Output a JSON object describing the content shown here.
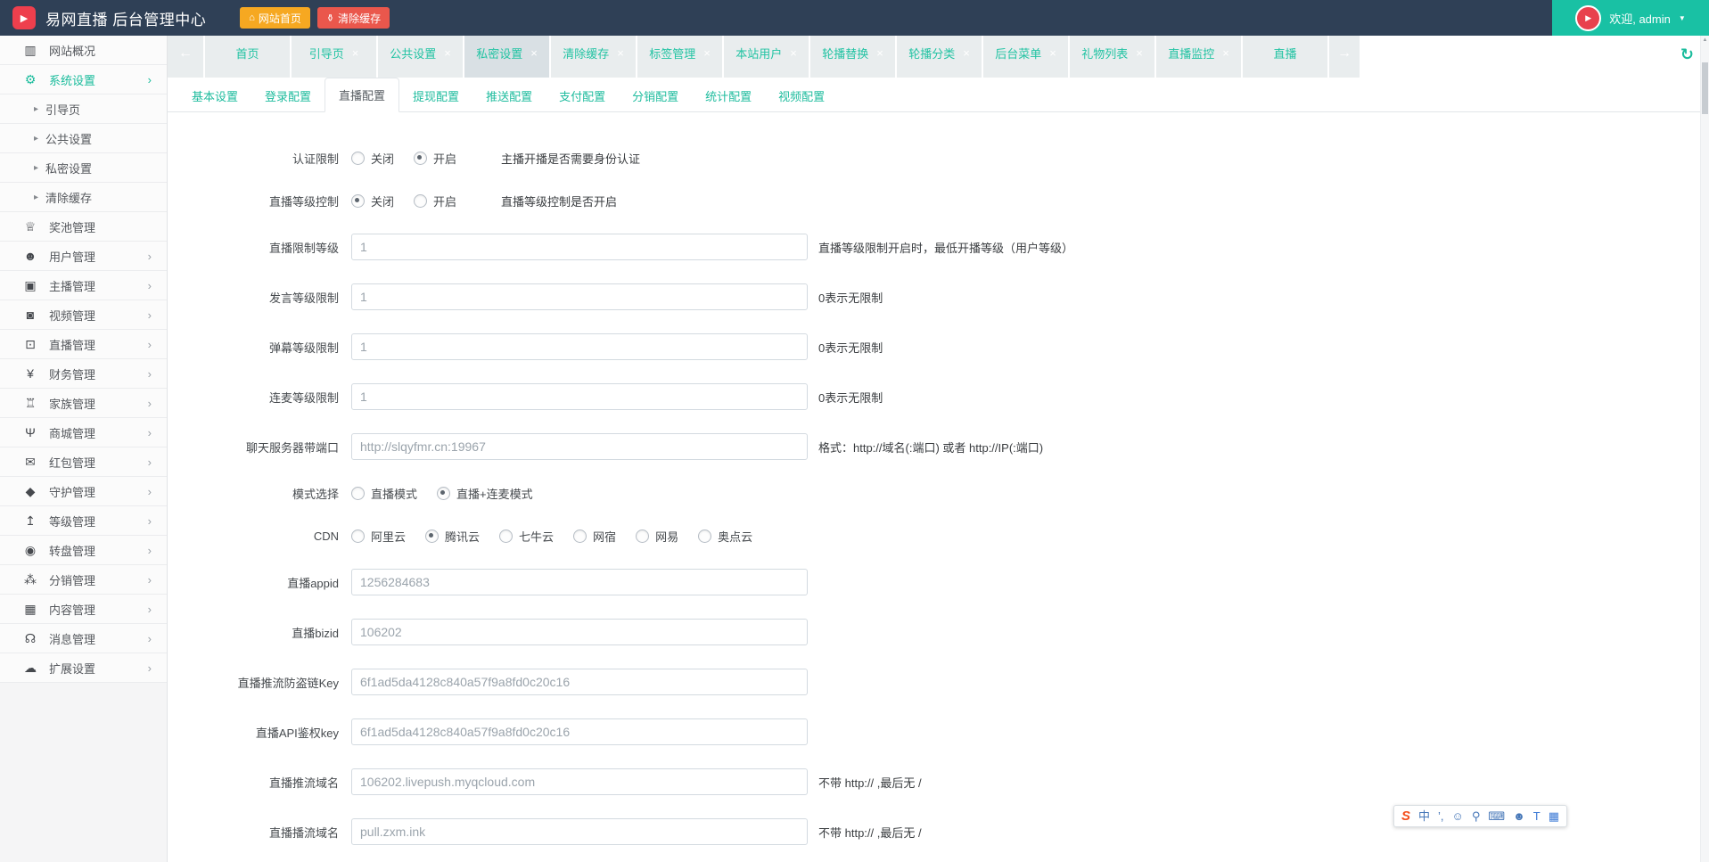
{
  "colors": {
    "header_bg": "#2f4056",
    "accent_teal": "#1abc9c",
    "welcome_bg": "#19c1a4",
    "home_button_bg": "#f6a821",
    "clear_button_bg": "#ea574c",
    "logo_red": "#ee3f4d",
    "tab_bg": "#e9edee",
    "active_tab_bg": "#d9e0e4"
  },
  "icons": {
    "play-icon": "▶",
    "home-icon": "⌂",
    "trash-icon": "⚱",
    "caret-down-icon": "▼",
    "scroll-left-icon": "←",
    "scroll-right-icon": "→",
    "refresh-icon": "↻",
    "close-icon": "×",
    "chevron-right-icon": "›",
    "submenu-arrow-icon": "▸",
    "scroll-up-icon": "▲",
    "chart-icon": "▥",
    "gears-icon": "⚙",
    "trophy-icon": "♕",
    "users-icon": "☻",
    "idcard-icon": "▣",
    "video-icon": "◙",
    "monitor-icon": "⊡",
    "yen-icon": "¥",
    "bank-icon": "♖",
    "cart-icon": "Ψ",
    "envelope-icon": "✉",
    "shield-icon": "◆",
    "level-up-icon": "↥",
    "wheel-icon": "◉",
    "sitemap-icon": "⁂",
    "grid-icon": "▦",
    "bell-icon": "☊",
    "cloud-icon": "☁"
  },
  "header": {
    "title": "易网直播 后台管理中心",
    "home_button": "网站首页",
    "clear_cache_button": "清除缓存",
    "welcome": "欢迎, admin"
  },
  "sidebar": {
    "items": [
      {
        "label": "网站概况",
        "icon": "chart-icon"
      },
      {
        "label": "系统设置",
        "icon": "gears-icon",
        "chevron": true,
        "active": true
      },
      {
        "label": "引导页",
        "sub": true
      },
      {
        "label": "公共设置",
        "sub": true
      },
      {
        "label": "私密设置",
        "sub": true
      },
      {
        "label": "清除缓存",
        "sub": true
      },
      {
        "label": "奖池管理",
        "icon": "trophy-icon"
      },
      {
        "label": "用户管理",
        "icon": "users-icon",
        "chevron": true
      },
      {
        "label": "主播管理",
        "icon": "idcard-icon",
        "chevron": true
      },
      {
        "label": "视频管理",
        "icon": "video-icon",
        "chevron": true
      },
      {
        "label": "直播管理",
        "icon": "monitor-icon",
        "chevron": true
      },
      {
        "label": "财务管理",
        "icon": "yen-icon",
        "chevron": true
      },
      {
        "label": "家族管理",
        "icon": "bank-icon",
        "chevron": true
      },
      {
        "label": "商城管理",
        "icon": "cart-icon",
        "chevron": true
      },
      {
        "label": "红包管理",
        "icon": "envelope-icon",
        "chevron": true
      },
      {
        "label": "守护管理",
        "icon": "shield-icon",
        "chevron": true
      },
      {
        "label": "等级管理",
        "icon": "level-up-icon",
        "chevron": true
      },
      {
        "label": "转盘管理",
        "icon": "wheel-icon",
        "chevron": true
      },
      {
        "label": "分销管理",
        "icon": "sitemap-icon",
        "chevron": true
      },
      {
        "label": "内容管理",
        "icon": "grid-icon",
        "chevron": true
      },
      {
        "label": "消息管理",
        "icon": "bell-icon",
        "chevron": true
      },
      {
        "label": "扩展设置",
        "icon": "cloud-icon",
        "chevron": true
      }
    ]
  },
  "tabbar": {
    "tabs": [
      {
        "label": "首页",
        "closable": false
      },
      {
        "label": "引导页",
        "closable": true
      },
      {
        "label": "公共设置",
        "closable": true
      },
      {
        "label": "私密设置",
        "closable": true,
        "active": true
      },
      {
        "label": "清除缓存",
        "closable": true
      },
      {
        "label": "标签管理",
        "closable": true
      },
      {
        "label": "本站用户",
        "closable": true
      },
      {
        "label": "轮播替换",
        "closable": true
      },
      {
        "label": "轮播分类",
        "closable": true
      },
      {
        "label": "后台菜单",
        "closable": true
      },
      {
        "label": "礼物列表",
        "closable": true
      },
      {
        "label": "直播监控",
        "closable": true
      },
      {
        "label": "直播",
        "closable": false
      }
    ]
  },
  "subtabs": {
    "tabs": [
      {
        "label": "基本设置"
      },
      {
        "label": "登录配置"
      },
      {
        "label": "直播配置",
        "active": true
      },
      {
        "label": "提现配置"
      },
      {
        "label": "推送配置"
      },
      {
        "label": "支付配置"
      },
      {
        "label": "分销配置"
      },
      {
        "label": "统计配置"
      },
      {
        "label": "视频配置"
      }
    ]
  },
  "form": {
    "rows": [
      {
        "label": "认证限制",
        "type": "radio",
        "options": [
          {
            "label": "关闭",
            "checked": false
          },
          {
            "label": "开启",
            "checked": true
          }
        ],
        "hint": "主播开播是否需要身份认证"
      },
      {
        "label": "直播等级控制",
        "type": "radio",
        "options": [
          {
            "label": "关闭",
            "checked": true
          },
          {
            "label": "开启",
            "checked": false
          }
        ],
        "hint": "直播等级控制是否开启"
      },
      {
        "label": "直播限制等级",
        "type": "input",
        "value": "1",
        "hint": "直播等级限制开启时，最低开播等级（用户等级）"
      },
      {
        "label": "发言等级限制",
        "type": "input",
        "value": "1",
        "hint": "0表示无限制"
      },
      {
        "label": "弹幕等级限制",
        "type": "input",
        "value": "1",
        "hint": "0表示无限制"
      },
      {
        "label": "连麦等级限制",
        "type": "input",
        "value": "1",
        "hint": "0表示无限制"
      },
      {
        "label": "聊天服务器带端口",
        "type": "input",
        "value": "http://slqyfmr.cn:19967",
        "hint": "格式：http://域名(:端口) 或者 http://IP(:端口)"
      },
      {
        "label": "模式选择",
        "type": "radio",
        "options": [
          {
            "label": "直播模式",
            "checked": false
          },
          {
            "label": "直播+连麦模式",
            "checked": true
          }
        ],
        "hint": ""
      },
      {
        "label": "CDN",
        "type": "radio",
        "options": [
          {
            "label": "阿里云",
            "checked": false
          },
          {
            "label": "腾讯云",
            "checked": true
          },
          {
            "label": "七牛云",
            "checked": false
          },
          {
            "label": "网宿",
            "checked": false
          },
          {
            "label": "网易",
            "checked": false
          },
          {
            "label": "奥点云",
            "checked": false
          }
        ],
        "hint": ""
      },
      {
        "label": "直播appid",
        "type": "input",
        "value": "1256284683",
        "hint": ""
      },
      {
        "label": "直播bizid",
        "type": "input",
        "value": "106202",
        "hint": ""
      },
      {
        "label": "直播推流防盗链Key",
        "type": "input",
        "value": "6f1ad5da4128c840a57f9a8fd0c20c16",
        "hint": ""
      },
      {
        "label": "直播API鉴权key",
        "type": "input",
        "value": "6f1ad5da4128c840a57f9a8fd0c20c16",
        "hint": ""
      },
      {
        "label": "直播推流域名",
        "type": "input",
        "value": "106202.livepush.myqcloud.com",
        "hint": "不带 http:// ,最后无 /"
      },
      {
        "label": "直播播流域名",
        "type": "input",
        "value": "pull.zxm.ink",
        "hint": "不带 http:// ,最后无 /"
      }
    ]
  },
  "ime_bar": {
    "icons": [
      {
        "name": "sogou-logo-icon",
        "glyph": "S",
        "color": "#f4501e"
      },
      {
        "name": "chinese-mode-icon",
        "glyph": "中",
        "color": "#4677b8"
      },
      {
        "name": "punctuation-icon",
        "glyph": "’,",
        "color": "#4677b8"
      },
      {
        "name": "emoji-icon",
        "glyph": "☺",
        "color": "#4677b8"
      },
      {
        "name": "mic-icon",
        "glyph": "⚲",
        "color": "#4677b8"
      },
      {
        "name": "keyboard-icon",
        "glyph": "⌨",
        "color": "#4677b8"
      },
      {
        "name": "handwriting-icon",
        "glyph": "☻",
        "color": "#4677b8"
      },
      {
        "name": "skin-icon",
        "glyph": "T",
        "color": "#3f7cd6"
      },
      {
        "name": "toolbox-icon",
        "glyph": "▦",
        "color": "#3f7cd6"
      }
    ]
  }
}
